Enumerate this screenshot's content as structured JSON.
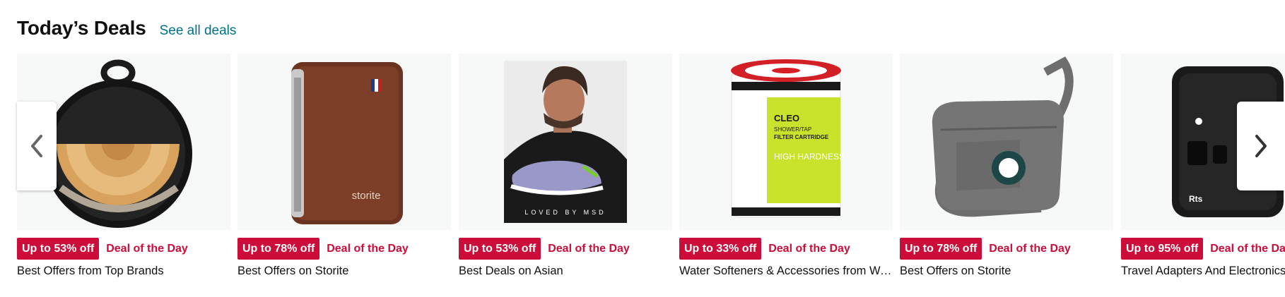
{
  "header": {
    "title": "Today’s Deals",
    "see_all": "See all deals"
  },
  "deals": [
    {
      "discount": "Up to 53% off",
      "badge": "Deal of the Day",
      "title": "Best Offers from Top Brands"
    },
    {
      "discount": "Up to 78% off",
      "badge": "Deal of the Day",
      "title": "Best Offers on Storite",
      "brand_text": "storite"
    },
    {
      "discount": "Up to 53% off",
      "badge": "Deal of the Day",
      "title": "Best Deals on Asian",
      "image_text": "LOVED BY MSD"
    },
    {
      "discount": "Up to 33% off",
      "badge": "Deal of the Day",
      "title": "Water Softeners & Accessories from Waterscience",
      "label_lines": [
        "CLEO",
        "SHOWER/TAP",
        "FILTER CARTRIDGE",
        "HIGH HARDNESS"
      ]
    },
    {
      "discount": "Up to 78% off",
      "badge": "Deal of the Day",
      "title": "Best Offers on Storite"
    },
    {
      "discount": "Up to 95% off",
      "badge": "Deal of the Day",
      "title": "Travel Adapters And Electronics",
      "brand_text": "Rts"
    }
  ],
  "nav": {
    "prev_icon": "chevron-left-icon",
    "next_icon": "chevron-right-icon"
  },
  "colors": {
    "deal_red": "#cc0c39",
    "link_teal": "#007185",
    "card_bg": "#f7f8f8",
    "text": "#0f1111"
  }
}
